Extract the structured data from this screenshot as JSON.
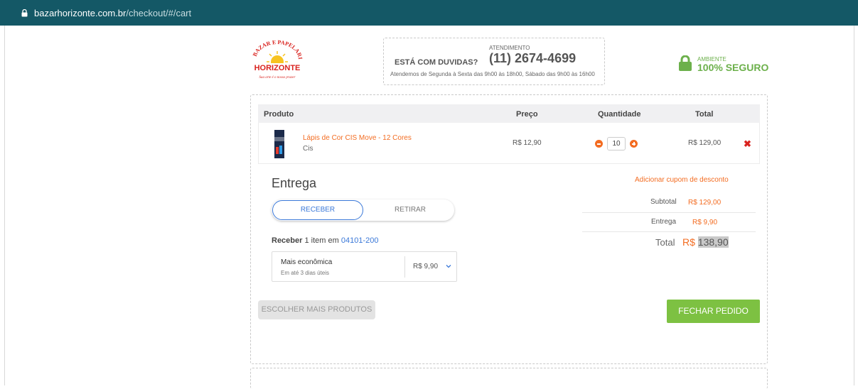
{
  "browser": {
    "url_host": "bazarhorizonte.com.br",
    "url_path": "/checkout/#/cart"
  },
  "header": {
    "logo": {
      "top_text": "BAZAR E PAPELARIA",
      "name": "HORIZONTE",
      "tagline": "Sua arte é o nosso prazer"
    },
    "support": {
      "question": "ESTÁ COM DUVIDAS?",
      "label": "ATENDIMENTO",
      "phone": "(11) 2674-4699",
      "hours": "Atendemos de Segunda à Sexta das 9h00 às 18h00, Sábado das 9h00 às 16h00"
    },
    "secure": {
      "small": "AMBIENTE",
      "big": "100% SEGURO",
      "color": "#6cb04b"
    }
  },
  "cart": {
    "columns": {
      "product": "Produto",
      "price": "Preço",
      "quantity": "Quantidade",
      "total": "Total"
    },
    "items": [
      {
        "name": "Lápis de Cor CIS Move - 12 Cores",
        "brand": "Cis",
        "price": "R$ 12,90",
        "quantity": "10",
        "total": "R$ 129,00"
      }
    ]
  },
  "delivery": {
    "title": "Entrega",
    "tab_active": "RECEBER",
    "tab_inactive": "RETIRAR",
    "receive_label": "Receber",
    "receive_text": "1 item em",
    "cep": "04101-200",
    "option": {
      "name": "Mais econômica",
      "days": "Em até 3 dias úteis",
      "price": "R$ 9,90"
    }
  },
  "summary": {
    "coupon_link": "Adicionar cupom de desconto",
    "subtotal_label": "Subtotal",
    "subtotal_value": "R$ 129,00",
    "delivery_label": "Entrega",
    "delivery_value": "R$ 9,90",
    "total_label": "Total",
    "total_currency": "R$",
    "total_value": "138,90"
  },
  "actions": {
    "more_products": "ESCOLHER MAIS PRODUTOS",
    "checkout": "FECHAR PEDIDO"
  },
  "colors": {
    "accent_orange": "#f36c21",
    "link_blue": "#3a78d8",
    "checkout_green": "#7dc142",
    "urlbar_teal": "#145866"
  }
}
